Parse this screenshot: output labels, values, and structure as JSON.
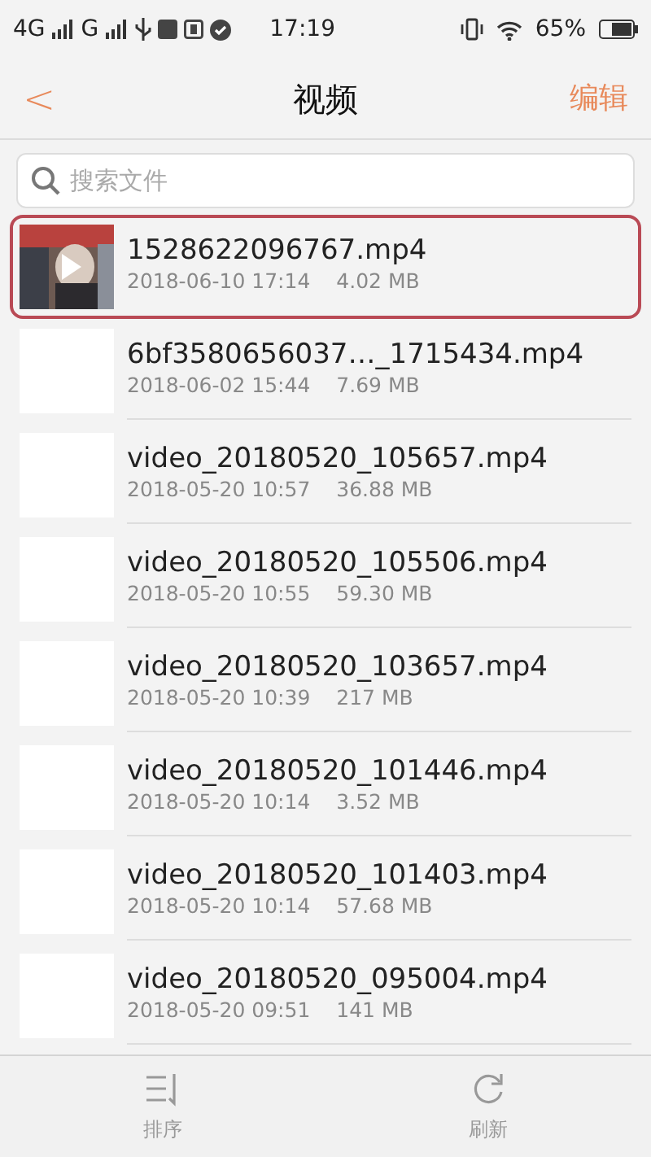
{
  "status_bar": {
    "network_1": "4G",
    "network_2": "G",
    "time": "17:19",
    "battery": "65%"
  },
  "header": {
    "back": "<",
    "title": "视频",
    "action": "编辑"
  },
  "search": {
    "placeholder": "搜索文件"
  },
  "files": [
    {
      "name": "1528622096767.mp4",
      "date": "2018-06-10 17:14",
      "size": "4.02 MB",
      "selected": true,
      "kind": "picture"
    },
    {
      "name": "6bf3580656037…_1715434.mp4",
      "date": "2018-06-02 15:44",
      "size": "7.69 MB",
      "selected": false,
      "kind": "blank"
    },
    {
      "name": "video_20180520_105657.mp4",
      "date": "2018-05-20 10:57",
      "size": "36.88 MB",
      "selected": false,
      "kind": "blank"
    },
    {
      "name": "video_20180520_105506.mp4",
      "date": "2018-05-20 10:55",
      "size": "59.30 MB",
      "selected": false,
      "kind": "blank"
    },
    {
      "name": "video_20180520_103657.mp4",
      "date": "2018-05-20 10:39",
      "size": "217 MB",
      "selected": false,
      "kind": "blank"
    },
    {
      "name": "video_20180520_101446.mp4",
      "date": "2018-05-20 10:14",
      "size": "3.52 MB",
      "selected": false,
      "kind": "blank"
    },
    {
      "name": "video_20180520_101403.mp4",
      "date": "2018-05-20 10:14",
      "size": "57.68 MB",
      "selected": false,
      "kind": "blank"
    },
    {
      "name": "video_20180520_095004.mp4",
      "date": "2018-05-20 09:51",
      "size": "141 MB",
      "selected": false,
      "kind": "blank"
    }
  ],
  "bottom_bar": [
    {
      "label": "排序",
      "kind": "sort"
    },
    {
      "label": "刷新",
      "kind": "refresh"
    }
  ]
}
